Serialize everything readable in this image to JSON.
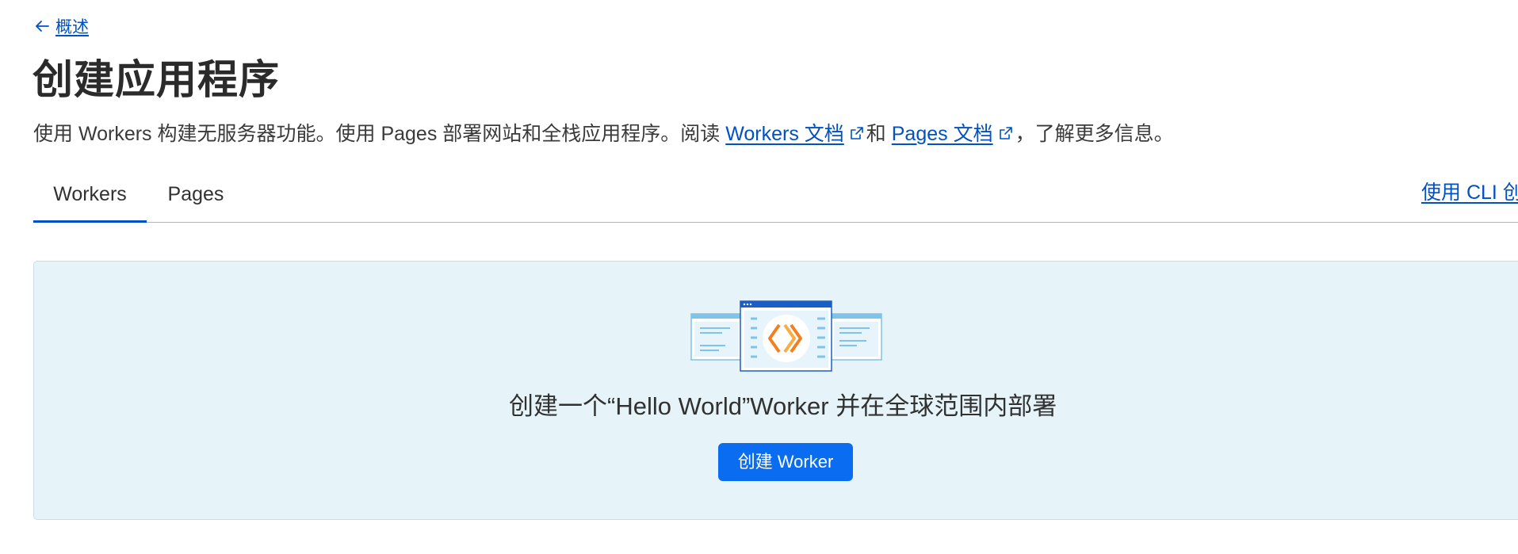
{
  "nav": {
    "back_label": "概述"
  },
  "header": {
    "title": "创建应用程序"
  },
  "description": {
    "part1": "使用 Workers 构建无服务器功能。使用 Pages 部署网站和全栈应用程序。阅读 ",
    "workers_docs_link": "Workers 文档",
    "part2": "和 ",
    "pages_docs_link": "Pages 文档",
    "part3": "，了解更多信息。"
  },
  "tabs": [
    {
      "label": "Workers",
      "active": true
    },
    {
      "label": "Pages",
      "active": false
    }
  ],
  "cli_link": "使用 CLI 创",
  "hero": {
    "heading": "创建一个“Hello World”Worker 并在全球范围内部署",
    "button_label": "创建 Worker"
  },
  "colors": {
    "accent": "#0051c3",
    "button": "#0a6cf0",
    "hero_bg": "#e6f4f9",
    "logo_orange": "#f38020"
  },
  "icons": {
    "back": "arrow-left-icon",
    "external": "external-link-icon",
    "illustration": "workers-illustration"
  }
}
